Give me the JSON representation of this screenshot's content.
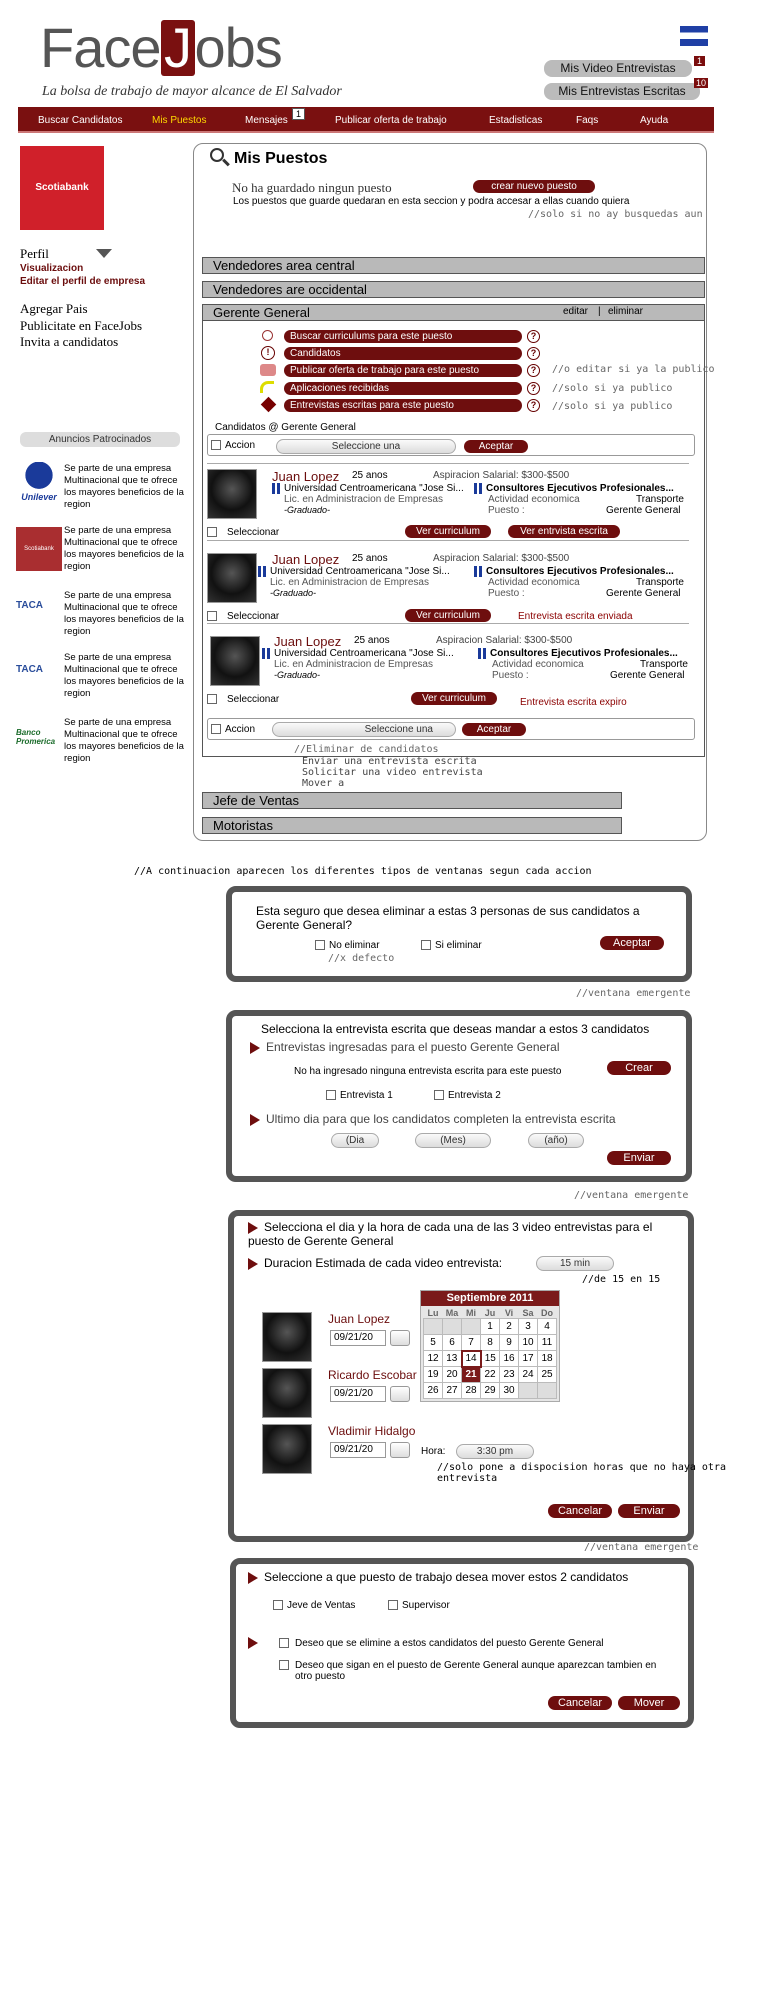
{
  "header": {
    "logo_face": "Face",
    "logo_j": "J",
    "logo_obs": "obs",
    "tagline": "La bolsa de trabajo de mayor alcance de El Salvador",
    "video_btn": "Mis Video Entrevistas",
    "video_count": "1",
    "written_btn": "Mis Entrevistas Escritas",
    "written_count": "10"
  },
  "nav": {
    "items": [
      "Buscar Candidatos",
      "Mis Puestos",
      "Mensajes",
      "Publicar oferta de trabajo",
      "Estadisticas",
      "Faqs",
      "Ayuda"
    ],
    "msg_count": "1"
  },
  "sidebar": {
    "company": "Scotiabank",
    "perfil": "Perfil",
    "visualizacion": "Visualizacion",
    "editar": "Editar el perfil de empresa",
    "links": [
      "Agregar Pais",
      "Publicitate en FaceJobs",
      "Invita a candidatos"
    ],
    "sponsored_title": "Anuncios Patrocinados",
    "ad_text": "Se parte de una empresa Multinacional que te ofrece los mayores beneficios de la region",
    "ads": [
      "Unilever",
      "Scotiabank",
      "TACA",
      "TACA",
      "Banco Promerica"
    ]
  },
  "main": {
    "title": "Mis Puestos",
    "none_saved": "No ha guardado ningun puesto",
    "create_btn": "crear nuevo puesto",
    "none_desc": "Los puestos  que guarde quedaran en esta seccion y podra accesar a ellas cuando quiera",
    "none_note": "//solo si no ay busquedas aun",
    "bars": [
      "Vendedores area central",
      "Vendedores are occidental",
      "Gerente General"
    ],
    "edit": "editar",
    "sep": "|",
    "delete": "eliminar",
    "actions": [
      "Buscar curriculums  para este puesto",
      "Candidatos",
      "Publicar oferta de trabajo para este puesto",
      "Aplicaciones recibidas",
      "Entrevistas escritas para este puesto"
    ],
    "action_notes": [
      "",
      "",
      "//o editar si ya la publico",
      "//solo si ya publico",
      "//solo si ya publico"
    ],
    "candidates_title": "Candidatos @ Gerente General",
    "accion": "Accion",
    "select_one": "Seleccione una",
    "accept": "Aceptar",
    "candidates": [
      {
        "name": "Juan Lopez",
        "age": "25 anos",
        "salary": "Aspiracion Salarial: $300-$500",
        "univ": "Universidad Centroamericana \"Jose Si...",
        "degree": "Lic. en Administracion de Empresas",
        "grad": "-Graduado-",
        "company": "Consultores Ejecutivos Profesionales...",
        "activity_label": "Actividad economica",
        "activity": "Transporte",
        "position_label": "Puesto :",
        "position": "Gerente General",
        "select": "Seleccionar",
        "cv": "Ver curriculum",
        "extra_btn": "Ver entrvista escrita",
        "status": ""
      },
      {
        "name": "Juan Lopez",
        "age": "25 anos",
        "salary": "Aspiracion Salarial: $300-$500",
        "univ": "Universidad Centroamericana \"Jose Si...",
        "degree": "Lic. en Administracion de Empresas",
        "grad": "-Graduado-",
        "company": "Consultores Ejecutivos Profesionales...",
        "activity_label": "Actividad economica",
        "activity": "Transporte",
        "position_label": "Puesto :",
        "position": "Gerente General",
        "select": "Seleccionar",
        "cv": "Ver curriculum",
        "extra_btn": "",
        "status": "Entrevista escrita enviada"
      },
      {
        "name": "Juan Lopez",
        "age": "25 anos",
        "salary": "Aspiracion Salarial: $300-$500",
        "univ": "Universidad Centroamericana \"Jose Si...",
        "degree": "Lic. en Administracion de Empresas",
        "grad": "-Graduado-",
        "company": "Consultores Ejecutivos Profesionales...",
        "activity_label": "Actividad economica",
        "activity": "Transporte",
        "position_label": "Puesto :",
        "position": "Gerente General",
        "select": "Seleccionar",
        "cv": "Ver curriculum",
        "extra_btn": "",
        "status": "Entrevista escrita expiro"
      }
    ],
    "dropdown": [
      "//Eliminar de candidatos",
      "Enviar  una entrevista escrita",
      "Solicitar  una video entrevista",
      "Mover a"
    ],
    "bars_after": [
      "Jefe de Ventas",
      "Motoristas"
    ]
  },
  "windows_note": "//A continuacion aparecen los diferentes tipos de ventanas segun cada accion",
  "popup1": {
    "question": "Esta seguro que desea eliminar a estas 3 personas de sus candidatos a Gerente General?",
    "no": "No eliminar",
    "yes": "Si eliminar",
    "accept": "Aceptar",
    "default_note": "//x defecto",
    "note": "//ventana emergente"
  },
  "popup2": {
    "title": "Selecciona la entrevista escrita que deseas mandar a estos 3 candidatos",
    "sub1": "Entrevistas ingresadas para el puesto Gerente General",
    "none": "No ha ingresado ninguna entrevista escrita para este puesto",
    "create": "Crear",
    "opt1": "Entrevista 1",
    "opt2": "Entrevista 2",
    "sub2": "Ultimo dia para que los candidatos completen la entrevista escrita",
    "day": "(Dia",
    "month": "(Mes)",
    "year": "(año)",
    "send": "Enviar",
    "note": "//ventana emergente"
  },
  "popup3": {
    "title": "Selecciona el dia y la hora de cada una de las 3 video entrevistas para el puesto de Gerente General",
    "duration_label": "Duracion Estimada de cada video entrevista:",
    "duration": "15 min",
    "duration_note": "//de 15 en 15",
    "people": [
      {
        "name": "Juan Lopez",
        "date": "09/21/20"
      },
      {
        "name": "Ricardo Escobar",
        "date": "09/21/20"
      },
      {
        "name": "Vladimir Hidalgo",
        "date": "09/21/20"
      }
    ],
    "hora_label": "Hora:",
    "hora": "3:30 pm",
    "hora_note": "//solo pone a dispocision horas que no haya otra entrevista",
    "cal_title": "Septiembre 2011",
    "cal_days": [
      "Lu",
      "Ma",
      "Mi",
      "Ju",
      "Vi",
      "Sa",
      "Do"
    ],
    "cal_rows": [
      [
        "",
        "",
        "",
        "1",
        "2",
        "3",
        "4"
      ],
      [
        "5",
        "6",
        "7",
        "8",
        "9",
        "10",
        "11"
      ],
      [
        "12",
        "13",
        "14",
        "15",
        "16",
        "17",
        "18"
      ],
      [
        "19",
        "20",
        "21",
        "22",
        "23",
        "24",
        "25"
      ],
      [
        "26",
        "27",
        "28",
        "29",
        "30",
        "",
        ""
      ]
    ],
    "cancel": "Cancelar",
    "send": "Enviar",
    "note": "//ventana emergente"
  },
  "popup4": {
    "title": "Seleccione a que puesto de trabajo desea mover estos 2 candidatos",
    "opt1": "Jeve de Ventas",
    "opt2": "Supervisor",
    "chk1": "Deseo que se elimine a estos candidatos del puesto Gerente General",
    "chk2": "Deseo que sigan en el puesto de Gerente General aunque aparezcan tambien en otro puesto",
    "cancel": "Cancelar",
    "move": "Mover"
  }
}
